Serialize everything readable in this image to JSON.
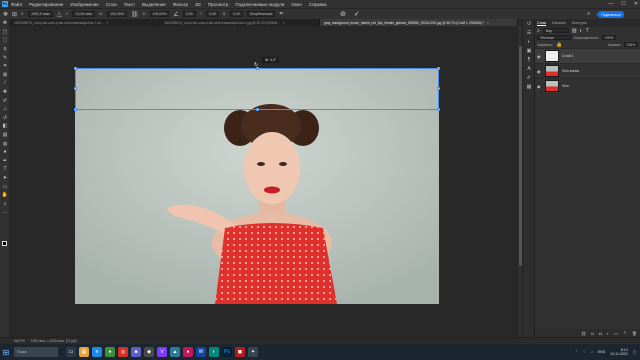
{
  "menubar": {
    "app_icon": "Ps",
    "items": [
      "Файл",
      "Редактирование",
      "Изображение",
      "Слои",
      "Текст",
      "Выделение",
      "Фильтр",
      "3D",
      "Просмотр",
      "Подключаемые модули",
      "Окно",
      "Справка"
    ]
  },
  "options": {
    "x_value": "1902,5 пикс",
    "y_value": "13,28 пикс",
    "w_value": "100,00%",
    "h_value": "100,00%",
    "angle_value": "0,00",
    "skew_h": "0,00",
    "skew_v": "0,00",
    "interp": "Бикубическая",
    "share_label": "Поделиться"
  },
  "tabs": [
    {
      "label": "1061005076_1-tmp-fon-oves-p-fon-serii-fotosessiya-foto-7-so...",
      "active": false
    },
    {
      "label": "1061005076_1-tmp-fon-oves-p-fon-serii-fotosessiya-foto-1.jpg @ 33,3% (RGB/8...",
      "active": false
    },
    {
      "label": "gray_background_brown_haired_red_lips_female_glamou_553686_1920x1200.jpg @ 66,7% (Слой 1, RGB/8#) *",
      "active": true
    }
  ],
  "canvas": {
    "size_tip": "Ш: 0,0°"
  },
  "layers_panel": {
    "tabs": [
      "Слои",
      "Каналы",
      "Контуры"
    ],
    "active_tab": "Слои",
    "kind_label": "Вид",
    "blend_mode": "Обычные",
    "opacity_label": "Непрозрачность:",
    "opacity_value": "100%",
    "lock_label": "Закрепить:",
    "fill_label": "Заливка:",
    "fill_value": "100%",
    "layers": [
      {
        "name": "Слой 1",
        "active": true
      },
      {
        "name": "Фон копия",
        "active": false
      },
      {
        "name": "Фон",
        "active": false
      }
    ]
  },
  "status": {
    "zoom": "66,67%",
    "doc_size": "1920 пикс. x 1200 пикс. (72 ppi)"
  },
  "taskbar": {
    "search_placeholder": "Поиск",
    "lang": "ENG",
    "time": "8:10",
    "date": "10.11.2022"
  },
  "colors": {
    "accent_blue": "#1473e6",
    "ps_blue": "#31a8ff",
    "dress_red": "#e0302b",
    "background_gray": "#282828"
  }
}
